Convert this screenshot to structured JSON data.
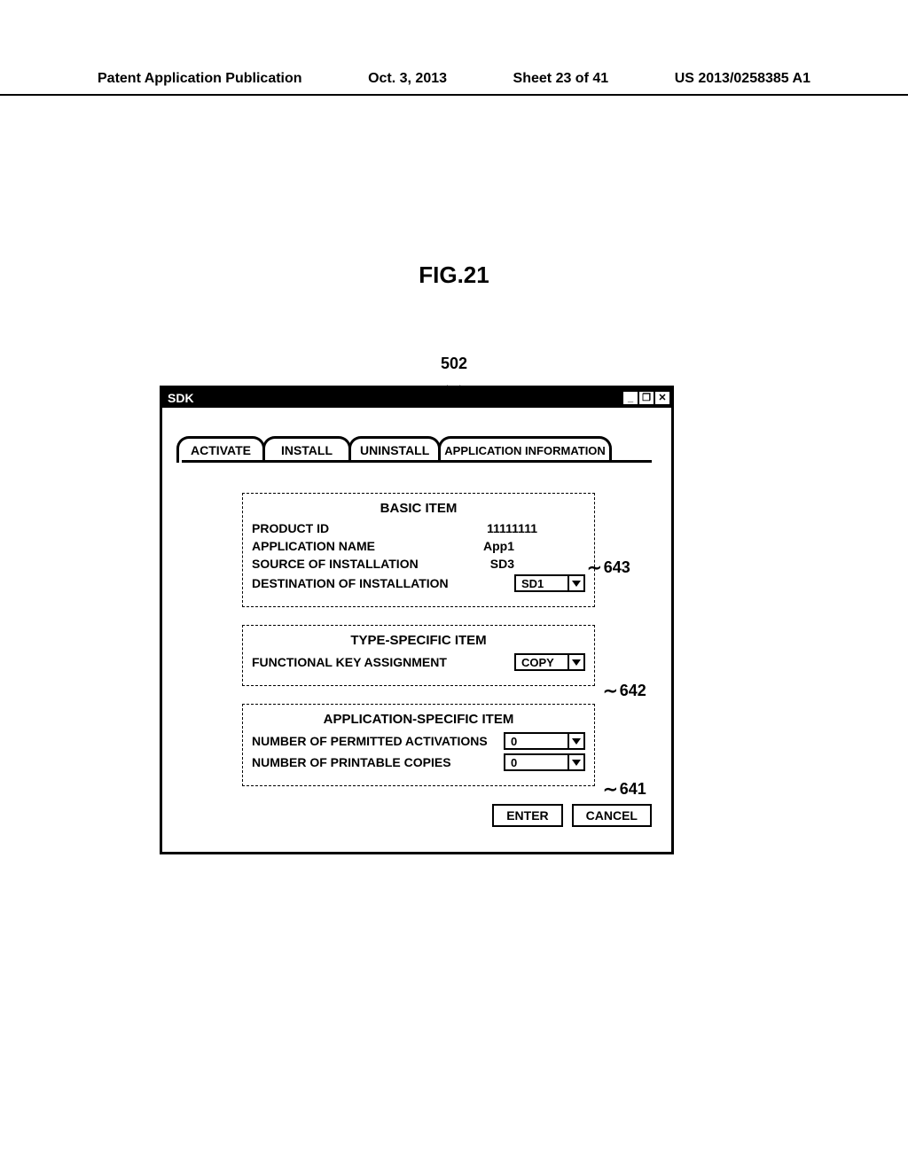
{
  "header": {
    "left": "Patent Application Publication",
    "date": "Oct. 3, 2013",
    "sheet": "Sheet 23 of 41",
    "pubno": "US 2013/0258385 A1"
  },
  "figure": {
    "title": "FIG.21",
    "window_ref": "502"
  },
  "callouts": {
    "basic_group": "643",
    "type_group": "642",
    "app_group": "641"
  },
  "window": {
    "title": "SDK",
    "controls": {
      "min": "_",
      "max": "❐",
      "close": "✕"
    },
    "tabs": {
      "activate": "ACTIVATE",
      "install": "INSTALL",
      "uninstall": "UNINSTALL",
      "appinfo": "APPLICATION INFORMATION"
    },
    "basic": {
      "title": "BASIC ITEM",
      "product_id_label": "PRODUCT ID",
      "product_id_value": "11111111",
      "app_name_label": "APPLICATION NAME",
      "app_name_value": "App1",
      "source_label": "SOURCE OF INSTALLATION",
      "source_value": "SD3",
      "dest_label": "DESTINATION OF INSTALLATION",
      "dest_value": "SD1"
    },
    "type": {
      "title": "TYPE-SPECIFIC ITEM",
      "funckey_label": "FUNCTIONAL KEY ASSIGNMENT",
      "funckey_value": "COPY"
    },
    "app": {
      "title": "APPLICATION-SPECIFIC ITEM",
      "activations_label": "NUMBER OF PERMITTED ACTIVATIONS",
      "activations_value": "0",
      "copies_label": "NUMBER OF PRINTABLE COPIES",
      "copies_value": "0"
    },
    "buttons": {
      "enter": "ENTER",
      "cancel": "CANCEL"
    }
  }
}
